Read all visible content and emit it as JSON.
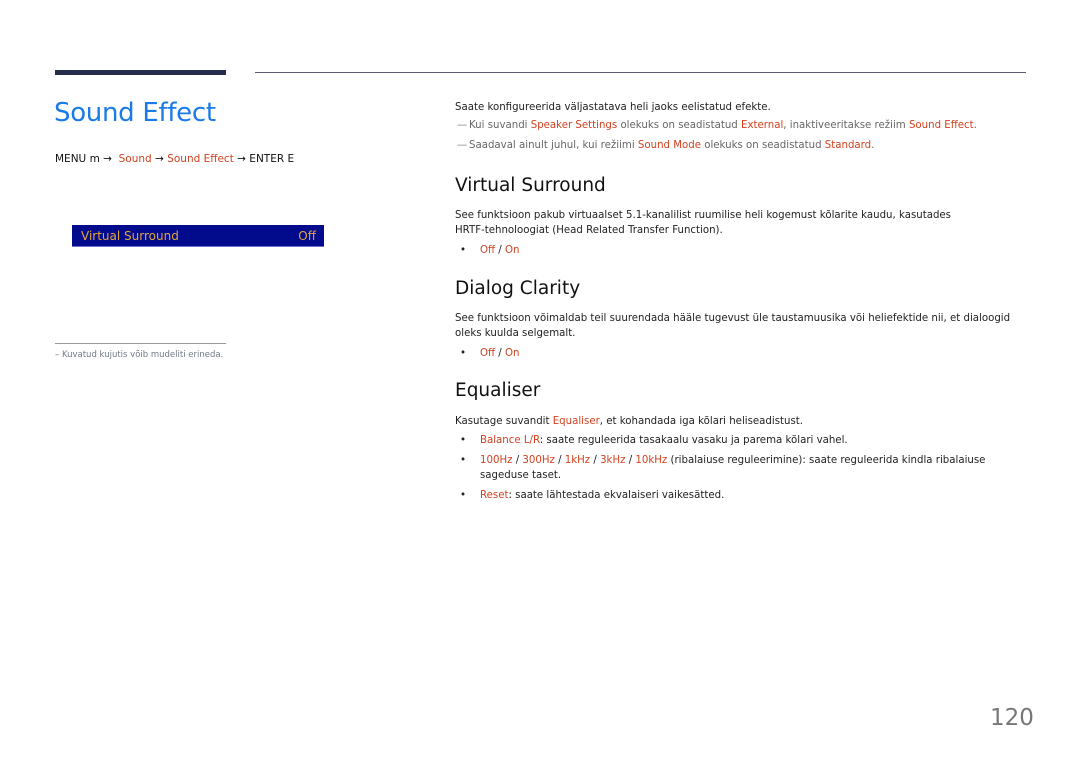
{
  "title": "Sound Effect",
  "breadcrumb": {
    "prefix": "MENU m →",
    "item1": "Sound",
    "arrow1": "→",
    "item2": "Sound Effect",
    "suffix": "→ ENTER E"
  },
  "osd_panel": {
    "label": "Virtual Surround",
    "value": "Off"
  },
  "left_note": "–  Kuvatud kujutis võib mudeliti erineda.",
  "intro": "Saate konfigureerida väljastatava heli jaoks eelistatud efekte.",
  "notes": [
    {
      "pre": "Kui suvandi ",
      "hl1": "Speaker Settings",
      "mid": " olekuks on seadistatud ",
      "hl2": "External",
      "mid2": ", inaktiveeritakse režiim ",
      "hl3": "Sound Effect",
      "post": "."
    },
    {
      "pre": "Saadaval ainult juhul, kui režiimi ",
      "hl1": "Sound Mode",
      "mid": " olekuks on seadistatud ",
      "hl2": "Standard",
      "post": "."
    }
  ],
  "sections": {
    "virtual_surround": {
      "heading": "Virtual Surround",
      "body": "See funktsioon pakub virtuaalset 5.1-kanalilist ruumilise heli kogemust kõlarite kaudu, kasutades HRTF-tehnoloogiat (Head Related Transfer Function).",
      "options": {
        "off": "Off",
        "sep": " / ",
        "on": "On"
      }
    },
    "dialog_clarity": {
      "heading": "Dialog Clarity",
      "body": "See funktsioon võimaldab teil suurendada hääle tugevust üle taustamuusika või heliefektide nii, et dialoogid oleks kuulda selgemalt.",
      "options": {
        "off": "Off",
        "sep": " / ",
        "on": "On"
      }
    },
    "equaliser": {
      "heading": "Equaliser",
      "body_pre": "Kasutage suvandit ",
      "body_hl": "Equaliser",
      "body_post": ", et kohandada iga kõlari heliseadistust.",
      "bullets": {
        "balance": {
          "hl": "Balance L/R",
          "text": ": saate reguleerida tasakaalu vasaku ja parema kõlari vahel."
        },
        "bands": {
          "b1": "100Hz",
          "b2": "300Hz",
          "b3": "1kHz",
          "b4": "3kHz",
          "b5": "10kHz",
          "sep": " / ",
          "text": " (ribalaiuse reguleerimine): saate reguleerida kindla ribalaiuse sageduse taset."
        },
        "reset": {
          "hl": "Reset",
          "text": ": saate lähtestada ekvalaiseri vaikesätted."
        }
      }
    }
  },
  "page_number": "120",
  "colors": {
    "title": "#1a7ae8",
    "highlight": "#d3411f",
    "osd_bg": "#020b8c",
    "osd_text": "#e3a53a"
  }
}
